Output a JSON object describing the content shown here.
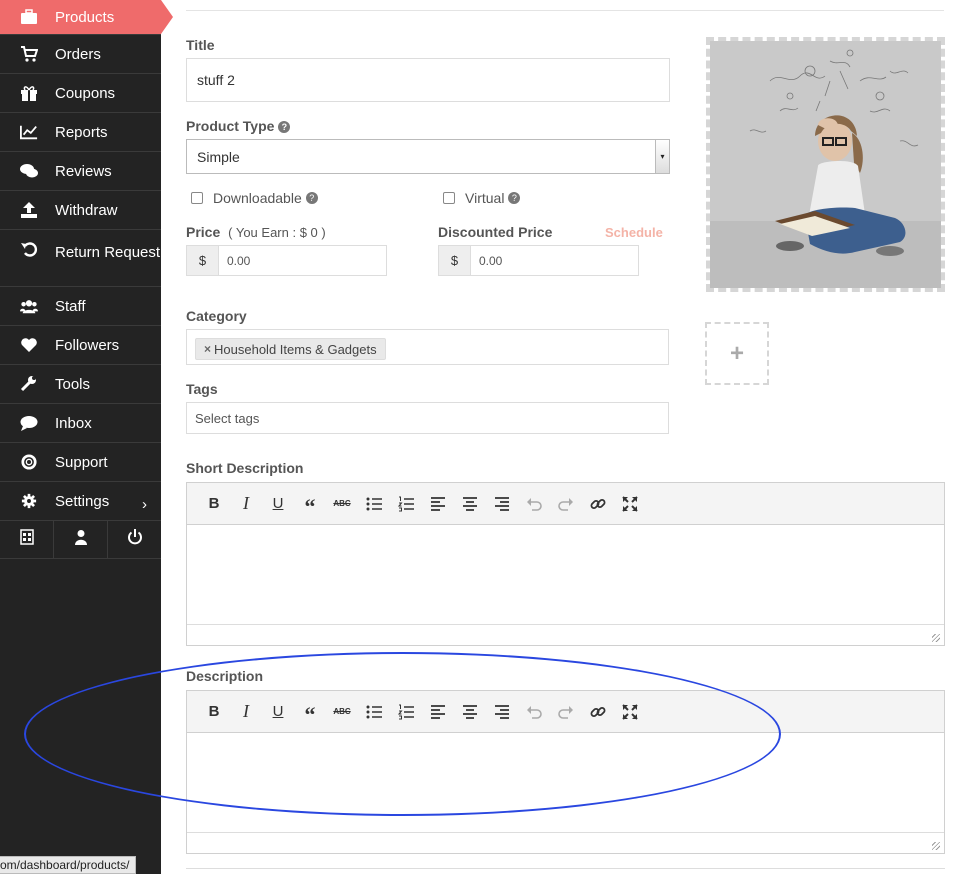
{
  "sidebar": {
    "items": [
      {
        "label": "Products",
        "icon": "briefcase-icon"
      },
      {
        "label": "Orders",
        "icon": "cart-icon"
      },
      {
        "label": "Coupons",
        "icon": "gift-icon"
      },
      {
        "label": "Reports",
        "icon": "line-chart-icon"
      },
      {
        "label": "Reviews",
        "icon": "comments-icon"
      },
      {
        "label": "Withdraw",
        "icon": "upload-icon"
      },
      {
        "label": "Return Request",
        "icon": "undo-icon"
      },
      {
        "label": "Staff",
        "icon": "users-icon"
      },
      {
        "label": "Followers",
        "icon": "heart-icon"
      },
      {
        "label": "Tools",
        "icon": "wrench-icon"
      },
      {
        "label": "Inbox",
        "icon": "comment-icon"
      },
      {
        "label": "Support",
        "icon": "lifebuoy-icon"
      },
      {
        "label": "Settings",
        "icon": "gear-icon"
      }
    ],
    "settings_chevron": "›",
    "footer": [
      "store-icon",
      "user-icon",
      "power-icon"
    ],
    "active_color": "#ef6b6b"
  },
  "status_url": "om/dashboard/products/",
  "form": {
    "title_label": "Title",
    "title_value": "stuff 2",
    "product_type_label": "Product Type",
    "product_type_value": "Simple",
    "downloadable_label": "Downloadable",
    "virtual_label": "Virtual",
    "price_label": "Price",
    "price_earn": "( You Earn : $ 0 )",
    "discounted_label": "Discounted Price",
    "schedule_label": "Schedule",
    "currency": "$",
    "price_value": "0.00",
    "discounted_value": "0.00",
    "category_label": "Category",
    "category_tag": "Household Items & Gadgets",
    "tags_label": "Tags",
    "tags_placeholder": "Select tags",
    "short_description_label": "Short Description",
    "description_label": "Description"
  },
  "add_image_symbol": "+",
  "toolbar": {
    "bold": "B",
    "italic": "I",
    "underline": "U",
    "quote": "“",
    "strike": "ABC"
  },
  "colors": {
    "highlight": "#2a47e0",
    "schedule": "#f4b3a7"
  }
}
